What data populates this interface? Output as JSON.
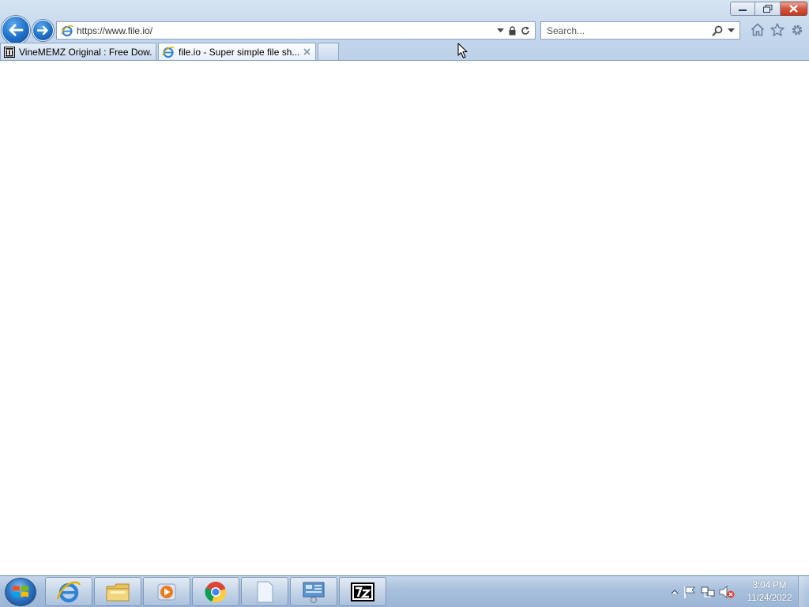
{
  "browser": {
    "address_url": "https://www.file.io/",
    "search_placeholder": "Search...",
    "tabs": [
      {
        "label": "VineMEMZ Original : Free Dow..."
      },
      {
        "label": "file.io - Super simple file sh..."
      },
      {
        "label": ""
      }
    ]
  },
  "taskbar": {
    "time": "3:04 PM",
    "date": "11/24/2022"
  },
  "icons": {
    "back": "back-arrow-icon",
    "forward": "forward-arrow-icon",
    "lock": "lock-icon",
    "refresh": "refresh-icon",
    "home": "home-icon",
    "favorites": "star-icon",
    "tools": "gear-icon"
  },
  "colors": {
    "chrome": "#c4d7ec",
    "nav_button": "#1f6fc8",
    "close_button": "#c43a22",
    "taskbar": "#a8c0dc"
  }
}
